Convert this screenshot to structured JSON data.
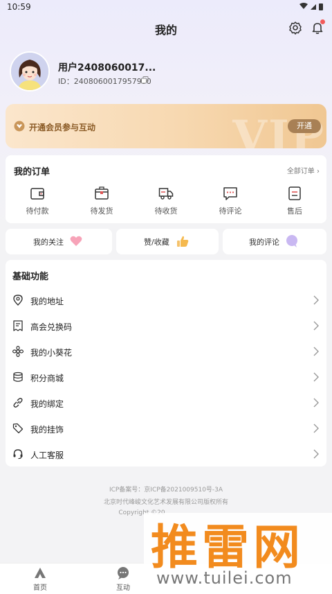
{
  "status_bar": {
    "time": "10:59",
    "icons": "▾◢▮"
  },
  "header": {
    "title": "我的"
  },
  "profile": {
    "username": "用户2408060017...",
    "user_id": "ID：2408060017957930"
  },
  "vip": {
    "text": "开通会员参与互动",
    "button": "开通",
    "watermark": "VIP"
  },
  "orders": {
    "title": "我的订单",
    "all_label": "全部订单 ›",
    "items": [
      {
        "label": "待付款",
        "icon": "wallet-icon"
      },
      {
        "label": "待发货",
        "icon": "package-icon"
      },
      {
        "label": "待收货",
        "icon": "truck-icon"
      },
      {
        "label": "待评论",
        "icon": "comment-icon"
      },
      {
        "label": "售后",
        "icon": "after-sale-icon"
      }
    ]
  },
  "quick": [
    {
      "label": "我的关注",
      "icon": "heart-icon"
    },
    {
      "label": "赞/收藏",
      "icon": "thumbs-up-icon"
    },
    {
      "label": "我的评论",
      "icon": "chat-bubble-icon"
    }
  ],
  "basic": {
    "title": "基础功能",
    "items": [
      {
        "label": "我的地址",
        "icon": "location-pin-icon"
      },
      {
        "label": "高会兑换码",
        "icon": "receipt-icon"
      },
      {
        "label": "我的小葵花",
        "icon": "flower-icon"
      },
      {
        "label": "积分商城",
        "icon": "coins-icon"
      },
      {
        "label": "我的绑定",
        "icon": "link-icon"
      },
      {
        "label": "我的挂饰",
        "icon": "tag-icon"
      },
      {
        "label": "人工客服",
        "icon": "headset-icon"
      }
    ]
  },
  "footer": {
    "icp": "ICP备案号：京ICP备2021009510号-3A",
    "company": "北京时代峰峻文化艺术发展有限公司版权所有",
    "copyright": "Copyright ©20"
  },
  "tabs": [
    {
      "label": "首页",
      "icon": "home-icon"
    },
    {
      "label": "互动",
      "icon": "chat-icon"
    }
  ],
  "watermark": {
    "cn": "推雷网",
    "url": "www.tuilei.com"
  },
  "colors": {
    "vip_text": "#8a5a25",
    "vip_button": "#a88055",
    "accent_red": "#f25a5a"
  }
}
